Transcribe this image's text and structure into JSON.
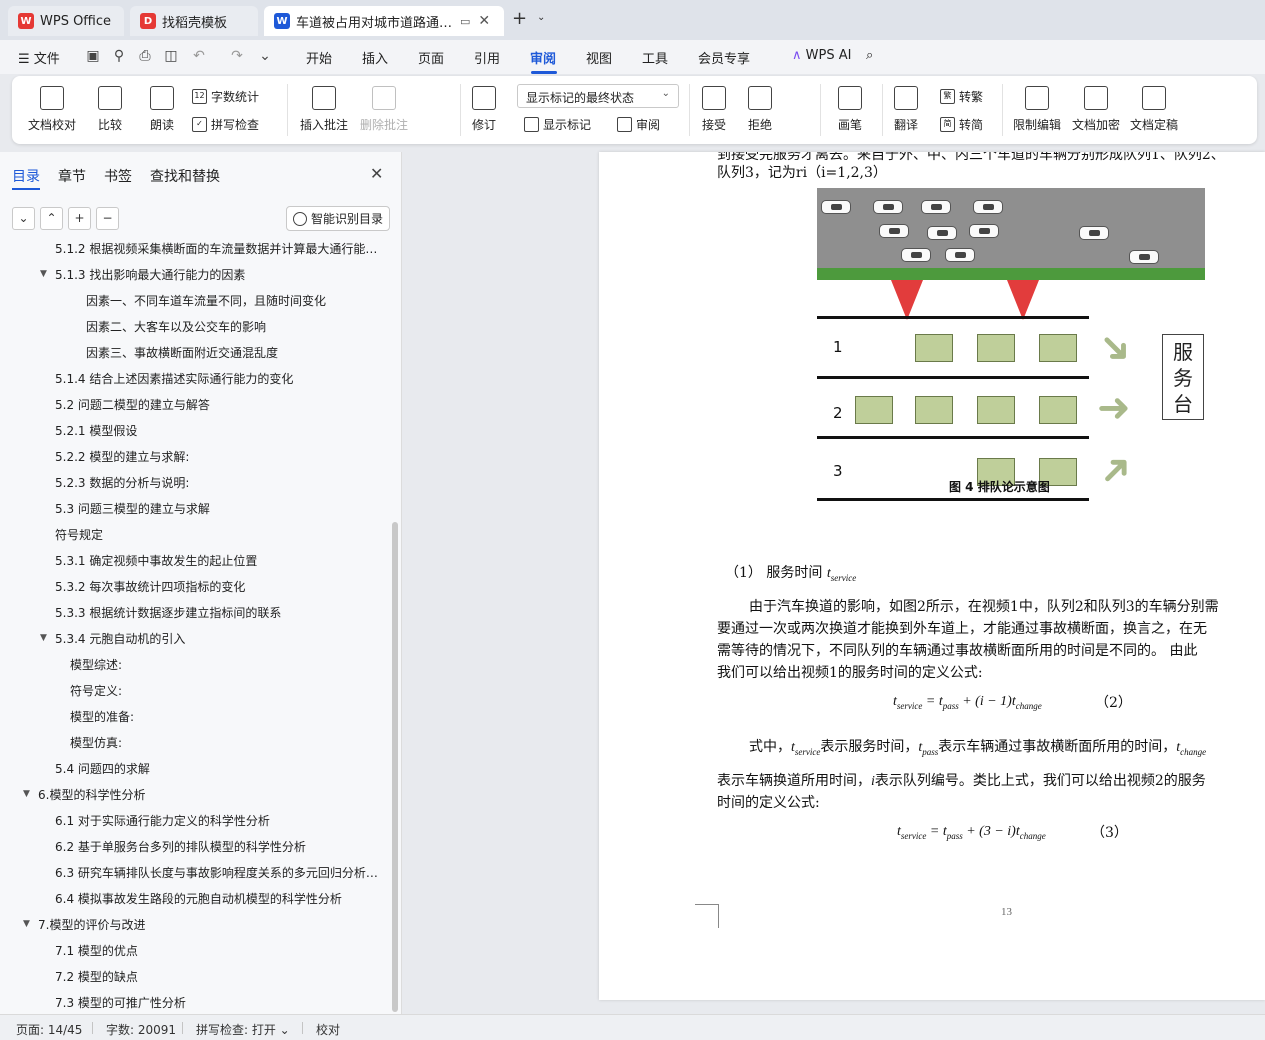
{
  "tabs": [
    {
      "label": "WPS Office",
      "icon": "wps-logo-icon",
      "color": "#e53935"
    },
    {
      "label": "找稻壳模板",
      "icon": "docer-logo-icon",
      "color": "#e53935"
    },
    {
      "label": "车道被占用对城市道路通行能",
      "icon": "writer-doc-icon",
      "color": "#1e59d8"
    }
  ],
  "menu": {
    "file": "文件",
    "items": [
      "开始",
      "插入",
      "页面",
      "引用",
      "审阅",
      "视图",
      "工具",
      "会员专享"
    ],
    "active": "审阅",
    "ai": "WPS AI"
  },
  "ribbon": {
    "doc_check": "文档校对",
    "compare": "比较",
    "read_aloud": "朗读",
    "word_count": "字数统计",
    "spell_check": "拼写检查",
    "insert_comment": "插入批注",
    "delete_comment": "删除批注",
    "track_changes": "修订",
    "markup_state": "显示标记的最终状态",
    "show_markup": "显示标记",
    "review": "审阅",
    "accept": "接受",
    "reject": "拒绝",
    "pen": "画笔",
    "translate": "翻译",
    "to_traditional": "转繁",
    "to_simplified": "转简",
    "restrict_edit": "限制编辑",
    "encrypt": "文档加密",
    "finalize": "文档定稿"
  },
  "nav": {
    "tabs": [
      "目录",
      "章节",
      "书签",
      "查找和替换"
    ],
    "smart_toc": "智能识别目录",
    "items": [
      {
        "text": "5.1.2 根据视频采集横断面的车流量数据并计算最大通行能…",
        "level": 2
      },
      {
        "text": "5.1.3 找出影响最大通行能力的因素",
        "level": 2,
        "expanded": true
      },
      {
        "text": "因素一、不同车道车流量不同，且随时间变化",
        "level": 4
      },
      {
        "text": "因素二、大客车以及公交车的影响",
        "level": 4
      },
      {
        "text": "因素三、事故横断面附近交通混乱度",
        "level": 4
      },
      {
        "text": "5.1.4 结合上述因素描述实际通行能力的变化",
        "level": 2
      },
      {
        "text": "5.2  问题二模型的建立与解答",
        "level": 2
      },
      {
        "text": "5.2.1  模型假设",
        "level": 2
      },
      {
        "text": "5.2.2  模型的建立与求解:",
        "level": 2
      },
      {
        "text": "5.2.3 数据的分析与说明:",
        "level": 2
      },
      {
        "text": "5.3  问题三模型的建立与求解",
        "level": 2
      },
      {
        "text": "符号规定",
        "level": 2
      },
      {
        "text": "5.3.1  确定视频中事故发生的起止位置",
        "level": 2
      },
      {
        "text": "5.3.2  每次事故统计四项指标的变化",
        "level": 2
      },
      {
        "text": "5.3.3  根据统计数据逐步建立指标间的联系",
        "level": 2
      },
      {
        "text": "5.3.4  元胞自动机的引入",
        "level": 2,
        "expanded": true
      },
      {
        "text": "模型综述:",
        "level": 3
      },
      {
        "text": "符号定义:",
        "level": 3
      },
      {
        "text": "模型的准备:",
        "level": 3
      },
      {
        "text": "模型仿真:",
        "level": 3
      },
      {
        "text": "5.4  问题四的求解",
        "level": 2
      },
      {
        "text": "6.模型的科学性分析",
        "level": 1,
        "expanded": true
      },
      {
        "text": "6.1 对于实际通行能力定义的科学性分析",
        "level": 2
      },
      {
        "text": "6.2  基于单服务台多列的排队模型的科学性分析",
        "level": 2
      },
      {
        "text": "6.3  研究车辆排队长度与事故影响程度关系的多元回归分析…",
        "level": 2
      },
      {
        "text": "6.4 模拟事故发生路段的元胞自动机模型的科学性分析",
        "level": 2
      },
      {
        "text": "7.模型的评价与改进",
        "level": 1,
        "expanded": true
      },
      {
        "text": "7.1  模型的优点",
        "level": 2
      },
      {
        "text": "7.2  模型的缺点",
        "level": 2
      },
      {
        "text": "7.3 模型的可推广性分析",
        "level": 2
      }
    ]
  },
  "document": {
    "line_top": "到接受完服务才离去。来自于外、中、内三个车道的车辆分别形成队列1、队列2、",
    "line_queue": "队列3，记为ri（i=1,2,3）",
    "figure": {
      "lanes": [
        "1",
        "2",
        "3"
      ],
      "service_desk": [
        "服",
        "务",
        "台"
      ],
      "caption": "图 4  排队论示意图"
    },
    "item1": "（1）  服务时间",
    "item1_var": "t",
    "item1_sub": "service",
    "para1": [
      "由于汽车换道的影响，如图2所示，在视频1中，队列2和队列3的车辆分别需",
      "要通过一次或两次换道才能换到外车道上，才能通过事故横断面，换言之，在无",
      "需等待的情况下，不同队列的车辆通过事故横断面所用的时间是不同的。 由此",
      "我们可以给出视频1的服务时间的定义公式:"
    ],
    "eq2_no": "（2）",
    "para2_a": "式中，",
    "para2_b": "表示服务时间，",
    "para2_c": "表示车辆通过事故横断面所用的时间，",
    "para3": [
      "表示车辆换道所用时间，",
      "表示队列编号。类比上式，我们可以给出视频2的服务",
      "时间的定义公式:"
    ],
    "eq3_no": "（3）",
    "page_number": "13"
  },
  "status": {
    "page": "页面: 14/45",
    "words": "字数: 20091",
    "spell": "拼写检查: 打开",
    "proof": "校对"
  }
}
